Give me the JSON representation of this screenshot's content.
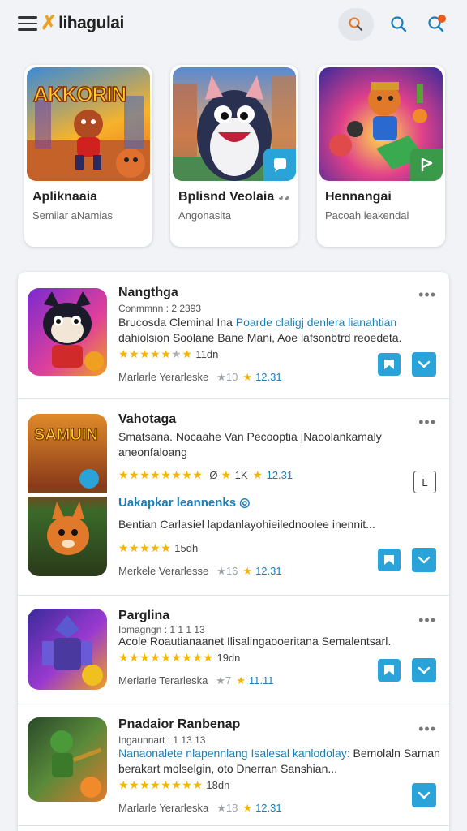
{
  "header": {
    "logo_mark": "✗",
    "logo_text": "lihagulai"
  },
  "featured": [
    {
      "art_title": "AKKORIN",
      "title": "Apliknaaia",
      "subtitle": "Semilar aNamias"
    },
    {
      "title": "Bplisnd Veolaia",
      "subtitle": "Angonasita"
    },
    {
      "title": "Hennangai",
      "subtitle": "Pacoah leakendal"
    }
  ],
  "list": [
    {
      "name": "Nangthga",
      "meta": "Conmmnn : 2 2393",
      "desc_plain": "Brucosda Cleminal Ina ",
      "desc_highlight": "Poarde claligj denlera lianahtian",
      "desc_rest": " dahiolsion Soolane Bane Mani, Aoe lafsonbtrd reoedeta.",
      "stars": "★★★★★",
      "stars_extra": "★",
      "count": "11dn",
      "foot_label": "Marlarle Yerarleske",
      "foot_gray": "★10",
      "foot_num": "12.31"
    },
    {
      "name": "Vahotaga",
      "desc": "Smatsana. Nocaahe Van Pecooptia |Naoolankamaly aneonfaloang",
      "stars": "★★★★★★★★",
      "count_k": "1K",
      "foot_num_a": "12.31",
      "link": "Uakapkar leannenks ◎",
      "desc2": "Bentian Carlasiel lapdanlayohieilednoolee inennit...",
      "stars2": "★★★★★",
      "count2": "15dh",
      "foot_label": "Merkele Verarlesse",
      "foot_gray": "★16",
      "foot_num": "12.31",
      "outline_label": "L"
    },
    {
      "name": "Parglina",
      "meta": "Iomagngn : 1 1 1 13",
      "desc": "Acole Roautianaanet Ilisalingaooeritana Semalentsarl.",
      "stars": "★★★★★★★★★",
      "count": "19dn",
      "foot_label": "Merlarle Terarleska",
      "foot_gray": "★7",
      "foot_num": "11.11"
    },
    {
      "name": "Pnadaior Ranbenap",
      "meta": "Ingaunnart : 1 13 13",
      "desc_highlight": "Nanaonalete nlapennlang Isalesal kanlodolay:",
      "desc_rest": " Bemolaln Sarnan berakart molselgin, oto Dnerran Sanshian...",
      "stars": "★★★★★★★★",
      "count": "18dn",
      "foot_label": "Marlarle Yerarleska",
      "foot_gray": "★18",
      "foot_num": "12.31"
    }
  ],
  "colors": {
    "accent": "#2aa3d9",
    "link": "#1a7fb8",
    "star": "#f4b400",
    "notify": "#e85d1f"
  }
}
